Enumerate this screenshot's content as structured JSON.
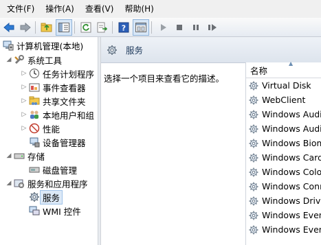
{
  "menu": {
    "file": "文件(F)",
    "action": "操作(A)",
    "view": "查看(V)",
    "help": "帮助(H)"
  },
  "toolbar": {
    "icons": [
      "back-arrow-icon",
      "forward-arrow-icon",
      "up-folder-icon",
      "show-hide-tree-icon",
      "refresh-icon",
      "export-list-icon",
      "help-icon",
      "properties-icon",
      "start-service-icon",
      "stop-service-icon",
      "pause-service-icon",
      "restart-service-icon"
    ]
  },
  "tree": {
    "root": "计算机管理(本地)",
    "system_tools": "系统工具",
    "task_scheduler": "任务计划程序",
    "event_viewer": "事件查看器",
    "shared_folders": "共享文件夹",
    "local_users": "本地用户和组",
    "performance": "性能",
    "device_manager": "设备管理器",
    "storage": "存储",
    "disk_management": "磁盘管理",
    "services_apps": "服务和应用程序",
    "services": "服务",
    "wmi": "WMI 控件"
  },
  "right_pane": {
    "title": "服务",
    "description": "选择一个项目来查看它的描述。",
    "column_name": "名称",
    "services": [
      "Virtual Disk",
      "WebClient",
      "Windows Audio",
      "Windows Audio Endpoint Builder",
      "Windows Biometric Service",
      "Windows CardSpace",
      "Windows Color System",
      "Windows Connect Now",
      "Windows Driver Foundation",
      "Windows Event Collector",
      "Windows Event Log"
    ]
  },
  "colors": {
    "menu_bg": "#f0f0f0",
    "header_title": "#1e395b",
    "selection": "#dce9f7"
  }
}
